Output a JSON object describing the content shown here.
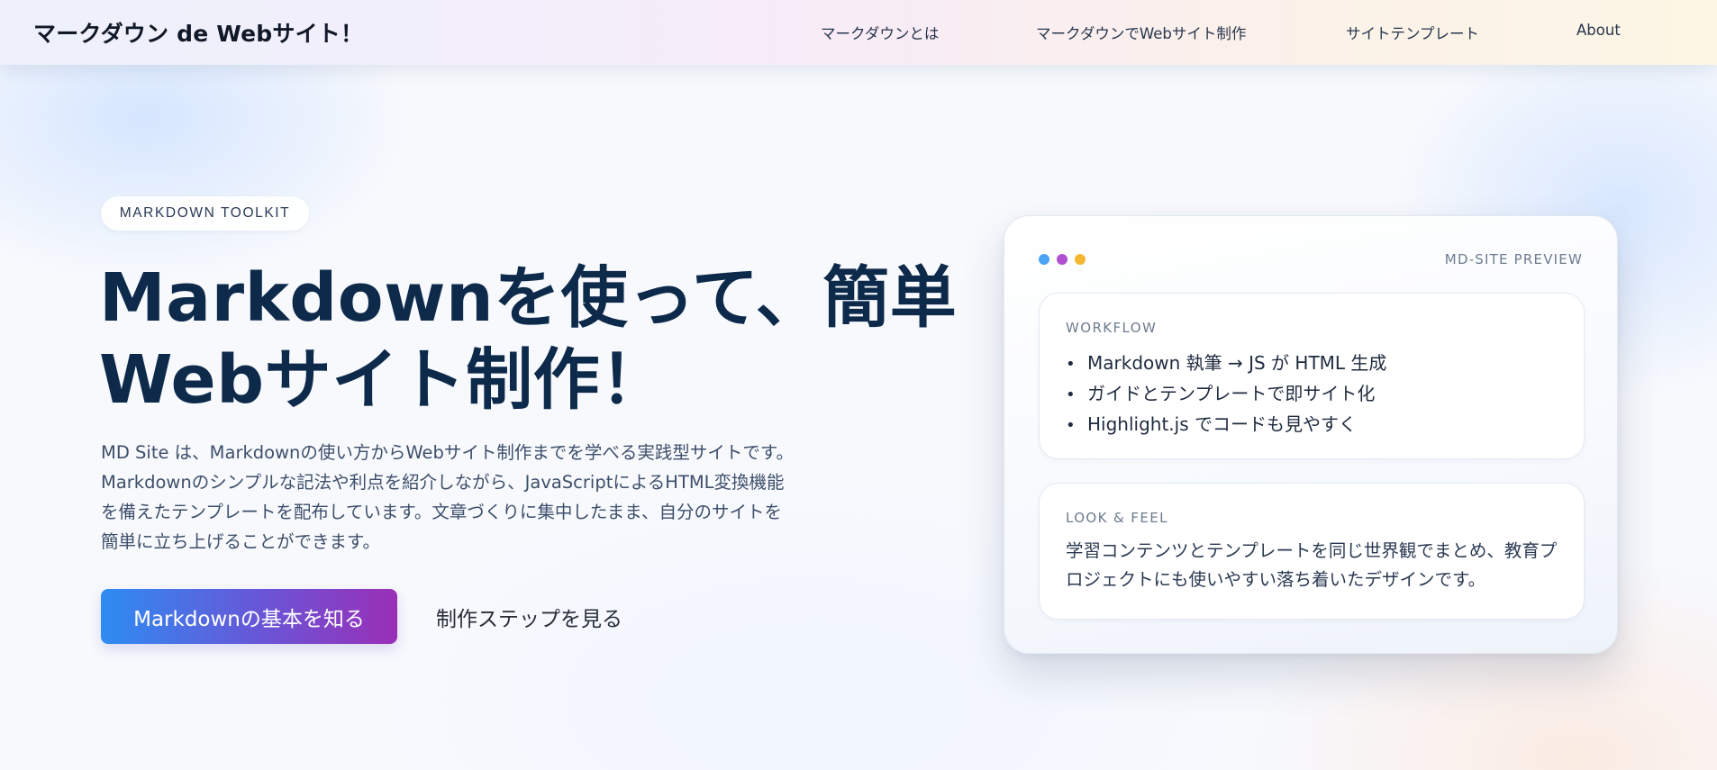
{
  "header": {
    "brand": "マークダウン de Webサイト！",
    "nav": [
      {
        "label": "マークダウンとは"
      },
      {
        "label": "マークダウンでWebサイト制作"
      },
      {
        "label": "サイトテンプレート"
      },
      {
        "label": "About"
      }
    ]
  },
  "hero": {
    "eyebrow": "MARKDOWN TOOLKIT",
    "title_line1": "Markdownを使って、簡単",
    "title_line2": "Webサイト制作！",
    "description": "MD Site は、Markdownの使い方からWebサイト制作までを学べる実践型サイトです。Markdownのシンプルな記法や利点を紹介しながら、JavaScriptによるHTML変換機能を備えたテンプレートを配布しています。文章づくりに集中したまま、自分のサイトを簡単に立ち上げることができます。",
    "primary_button": "Markdownの基本を知る",
    "secondary_button": "制作ステップを見る"
  },
  "preview": {
    "label": "MD-SITE PREVIEW",
    "dot_colors": [
      "#4aa3f5",
      "#b04fd0",
      "#f5b731"
    ],
    "workflow": {
      "eyebrow": "WORKFLOW",
      "items": [
        "Markdown 執筆 → JS が HTML 生成",
        "ガイドとテンプレートで即サイト化",
        "Highlight.js でコードも見やすく"
      ]
    },
    "look": {
      "eyebrow": "LOOK & FEEL",
      "text": "学習コンテンツとテンプレートを同じ世界観でまとめ、教育プロジェクトにも使いやすい落ち着いたデザインです。"
    }
  }
}
